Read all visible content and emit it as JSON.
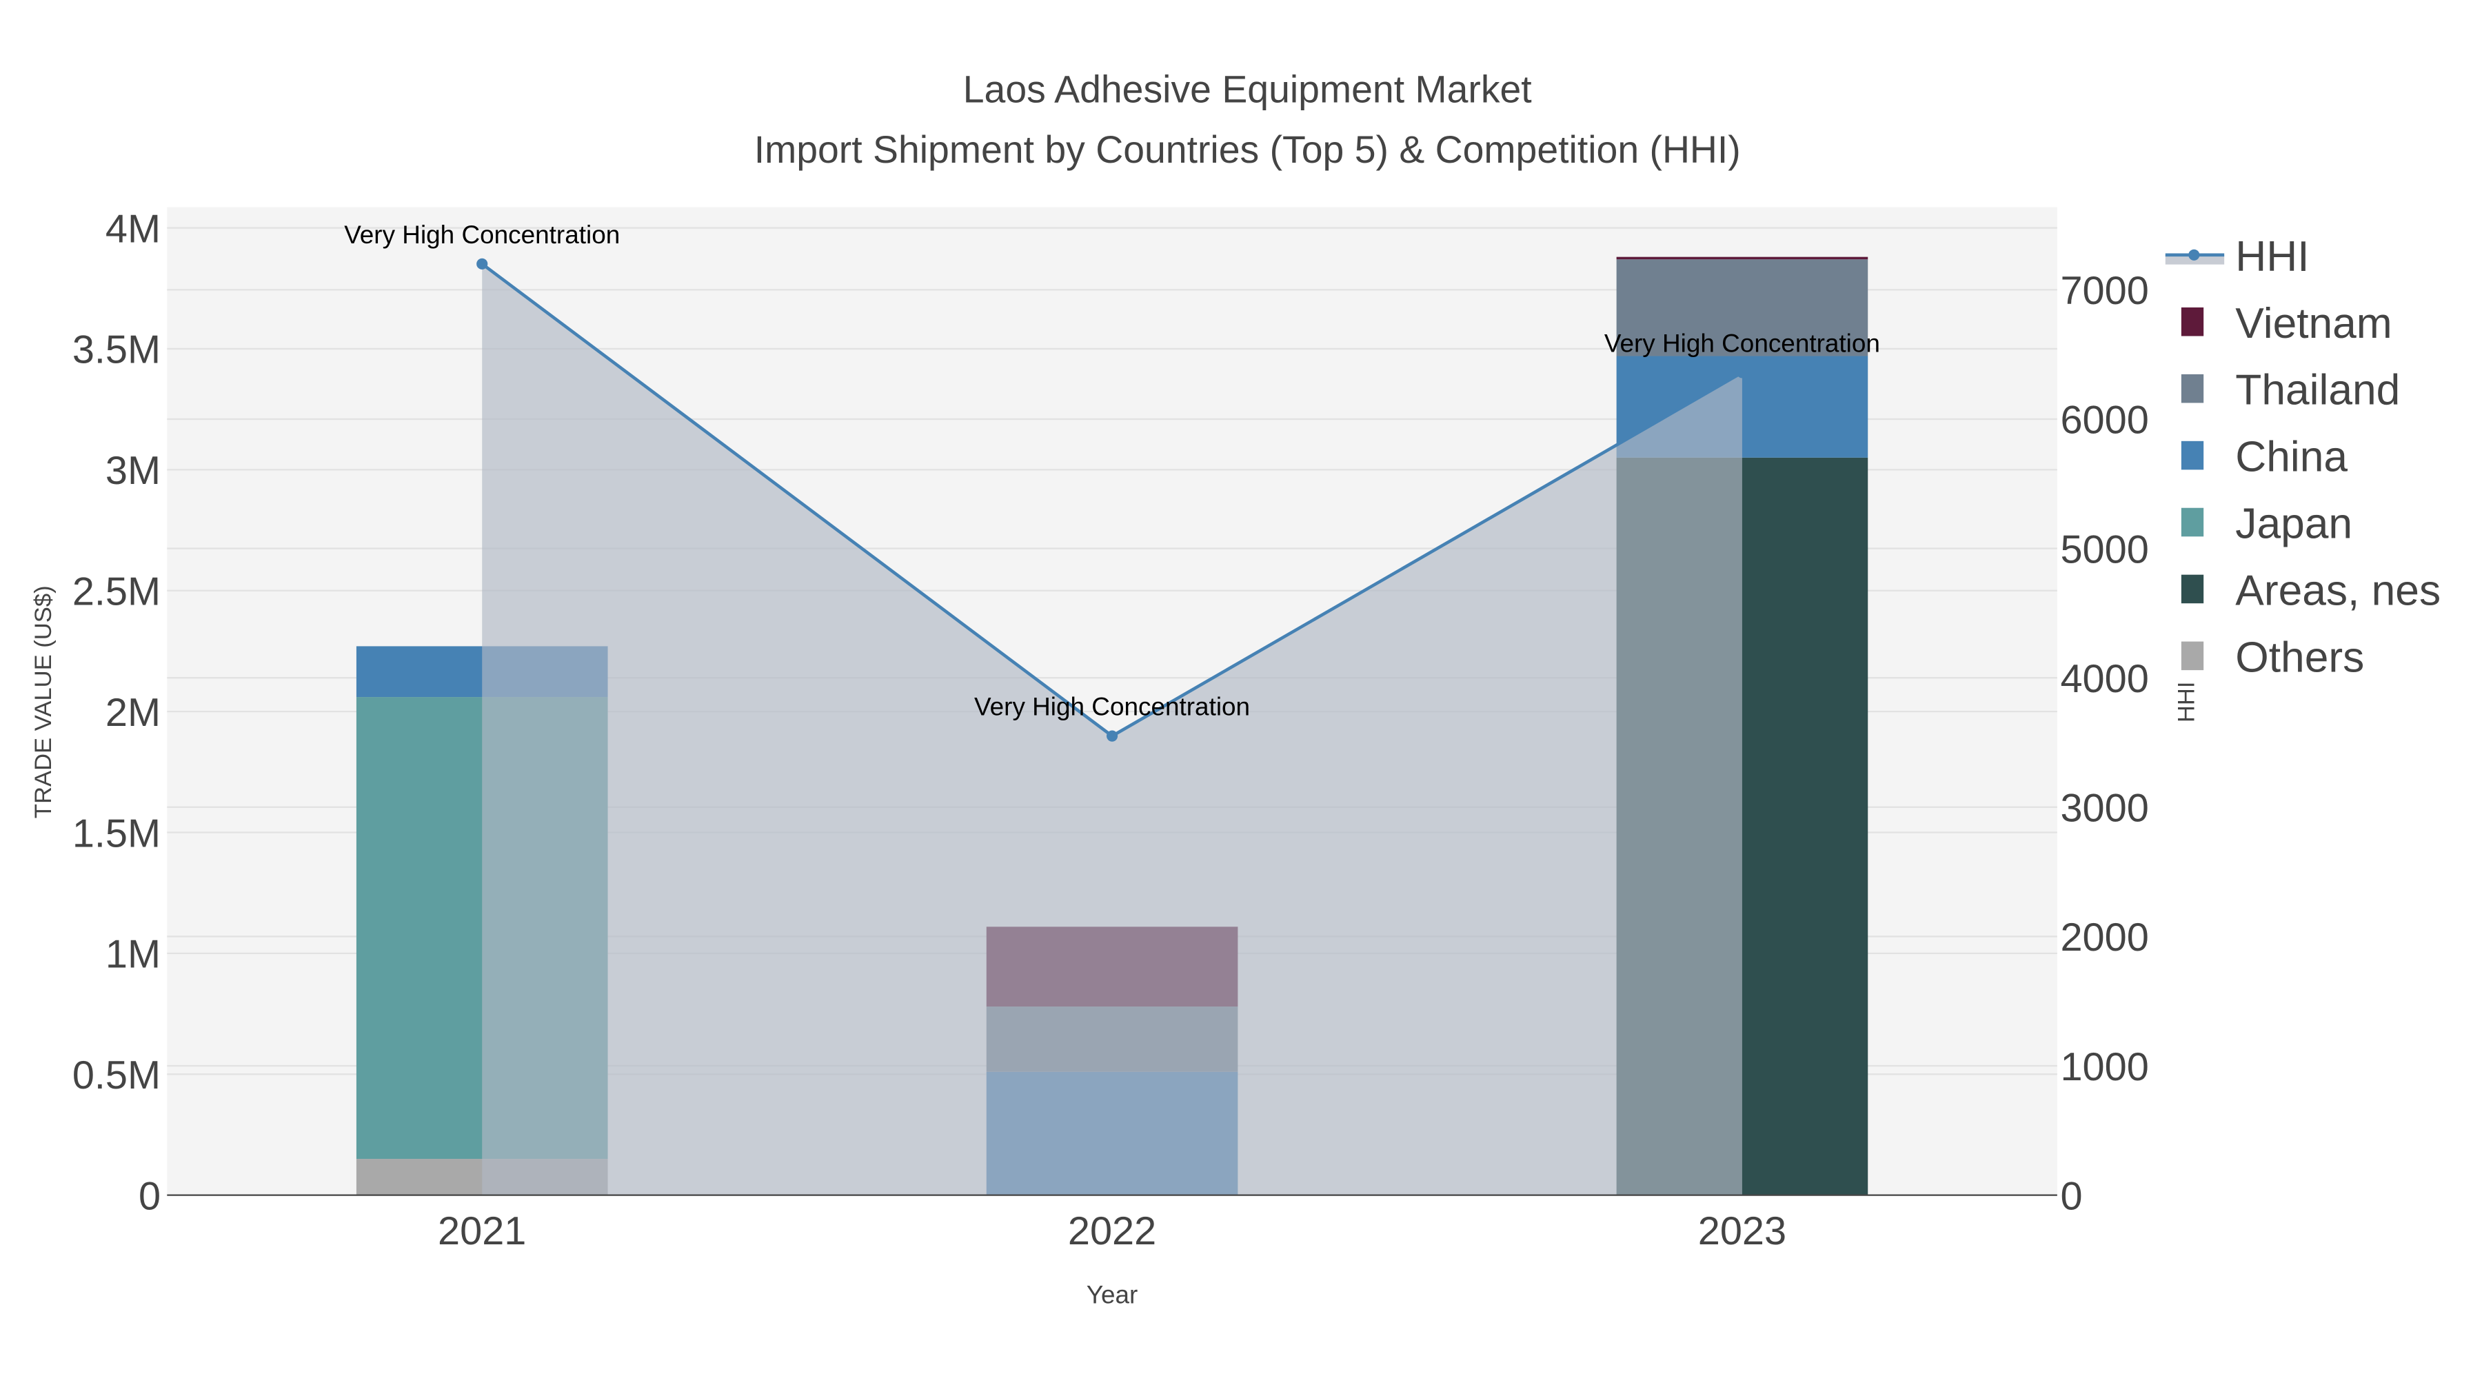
{
  "chart_data": {
    "type": "bar",
    "title": "Laos Adhesive Equipment Market",
    "subtitle": "Import Shipment by Countries (Top 5) & Competition (HHI)",
    "xlabel": "Year",
    "ylabel": "TRADE VALUE (US$)",
    "y2label": "HHI",
    "categories": [
      "2021",
      "2022",
      "2023"
    ],
    "ylim": [
      0,
      4000000
    ],
    "y2lim": [
      0,
      7600
    ],
    "yticks": [
      {
        "v": 0,
        "label": "0"
      },
      {
        "v": 500000,
        "label": "0.5M"
      },
      {
        "v": 1000000,
        "label": "1M"
      },
      {
        "v": 1500000,
        "label": "1.5M"
      },
      {
        "v": 2000000,
        "label": "2M"
      },
      {
        "v": 2500000,
        "label": "2.5M"
      },
      {
        "v": 3000000,
        "label": "3M"
      },
      {
        "v": 3500000,
        "label": "3.5M"
      },
      {
        "v": 4000000,
        "label": "4M"
      }
    ],
    "y2ticks": [
      {
        "v": 0,
        "label": "0"
      },
      {
        "v": 1000,
        "label": "1000"
      },
      {
        "v": 2000,
        "label": "2000"
      },
      {
        "v": 3000,
        "label": "3000"
      },
      {
        "v": 4000,
        "label": "4000"
      },
      {
        "v": 5000,
        "label": "5000"
      },
      {
        "v": 6000,
        "label": "6000"
      },
      {
        "v": 7000,
        "label": "7000"
      }
    ],
    "grid": true,
    "legend_placement": "right",
    "stack_order_bottom_to_top": [
      "Others",
      "Areas, nes",
      "Japan",
      "China",
      "Thailand",
      "Vietnam"
    ],
    "series": [
      {
        "name": "Vietnam",
        "color": "#5e1a3a",
        "values": [
          0,
          330000,
          10000
        ]
      },
      {
        "name": "Thailand",
        "color": "#708090",
        "values": [
          0,
          270000,
          400000
        ]
      },
      {
        "name": "China",
        "color": "#4682b4",
        "values": [
          210000,
          510000,
          420000
        ]
      },
      {
        "name": "Japan",
        "color": "#5f9ea0",
        "values": [
          1910000,
          0,
          0
        ]
      },
      {
        "name": "Areas, nes",
        "color": "#2f4f4f",
        "values": [
          0,
          0,
          3050000
        ]
      },
      {
        "name": "Others",
        "color": "#a9a9a9",
        "values": [
          150000,
          0,
          0
        ]
      }
    ],
    "hhi": {
      "name": "HHI",
      "color": "#4682b4",
      "values": [
        7200,
        3550,
        6360
      ],
      "annotations": [
        "Very High Concentration",
        "Very High Concentration",
        "Very High Concentration"
      ]
    },
    "legend": [
      "HHI",
      "Vietnam",
      "Thailand",
      "China",
      "Japan",
      "Areas, nes",
      "Others"
    ]
  }
}
